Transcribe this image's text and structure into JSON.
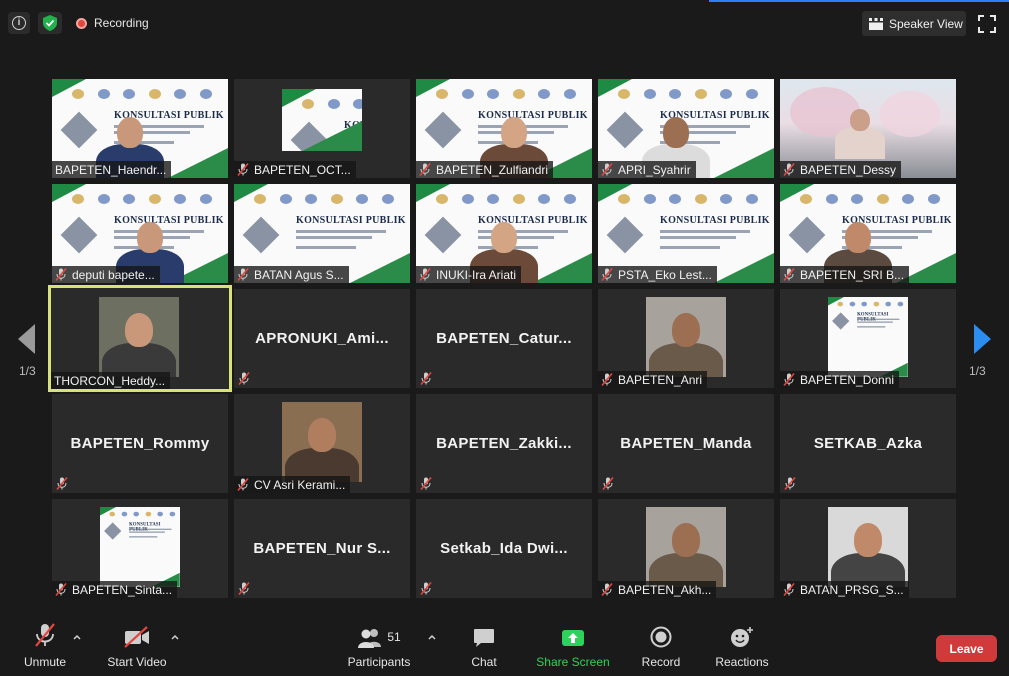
{
  "recording": {
    "label": "Recording"
  },
  "view": {
    "speaker_view_label": "Speaker View"
  },
  "navigation": {
    "left_page": "1/3",
    "right_page": "1/3"
  },
  "slide": {
    "title": "KONSULTASI PUBLIK"
  },
  "tiles": [
    {
      "name": "BAPETEN_Haendr...",
      "kind": "slide-person",
      "muted": false
    },
    {
      "name": "BAPETEN_OCT...",
      "kind": "slide-small",
      "muted": true
    },
    {
      "name": "BAPETEN_Zulfiandri",
      "kind": "slide-person",
      "muted": true
    },
    {
      "name": "APRI_Syahrir",
      "kind": "slide-person",
      "muted": true
    },
    {
      "name": "BAPETEN_Dessy",
      "kind": "outdoor",
      "muted": true
    },
    {
      "name": "deputi bapete...",
      "kind": "slide-person",
      "muted": true
    },
    {
      "name": "BATAN Agus S...",
      "kind": "slide",
      "muted": true
    },
    {
      "name": "INUKI-Ira Ariati",
      "kind": "slide-person",
      "muted": true
    },
    {
      "name": "PSTA_Eko Lest...",
      "kind": "slide",
      "muted": true
    },
    {
      "name": "BAPETEN_SRI B...",
      "kind": "slide-person",
      "muted": true
    },
    {
      "name": "THORCON_Heddy...",
      "kind": "video",
      "muted": false,
      "active": true
    },
    {
      "name": "APRONUKI_Ami...",
      "kind": "name-only",
      "muted": true
    },
    {
      "name": "BAPETEN_Catur...",
      "kind": "name-only",
      "muted": true
    },
    {
      "name": "BAPETEN_Anri",
      "kind": "video",
      "muted": true
    },
    {
      "name": "BAPETEN_Donni",
      "kind": "video-slide",
      "muted": true
    },
    {
      "name": "BAPETEN_Rommy",
      "kind": "name-only",
      "muted": true
    },
    {
      "name": "CV Asri Kerami...",
      "kind": "video",
      "muted": true
    },
    {
      "name": "BAPETEN_Zakki...",
      "kind": "name-only",
      "muted": true
    },
    {
      "name": "BAPETEN_Manda",
      "kind": "name-only",
      "muted": true
    },
    {
      "name": "SETKAB_Azka",
      "kind": "name-only",
      "muted": true
    },
    {
      "name": "BAPETEN_Sinta...",
      "kind": "video-slide",
      "muted": true
    },
    {
      "name": "BAPETEN_Nur  S...",
      "kind": "name-only",
      "muted": true
    },
    {
      "name": "Setkab_Ida  Dwi...",
      "kind": "name-only",
      "muted": true
    },
    {
      "name": "BAPETEN_Akh...",
      "kind": "video",
      "muted": true
    },
    {
      "name": "BATAN_PRSG_S...",
      "kind": "video",
      "muted": true
    }
  ],
  "toolbar": {
    "unmute": "Unmute",
    "start_video": "Start Video",
    "participants": "Participants",
    "participants_count": "51",
    "chat": "Chat",
    "share_screen": "Share Screen",
    "record": "Record",
    "reactions": "Reactions",
    "leave": "Leave"
  },
  "colors": {
    "accent": "#2d7ff9",
    "share_green": "#2fd15a",
    "leave_red": "#d13a3a",
    "mute_red": "#e0473f",
    "active_border": "#d8e27a"
  }
}
